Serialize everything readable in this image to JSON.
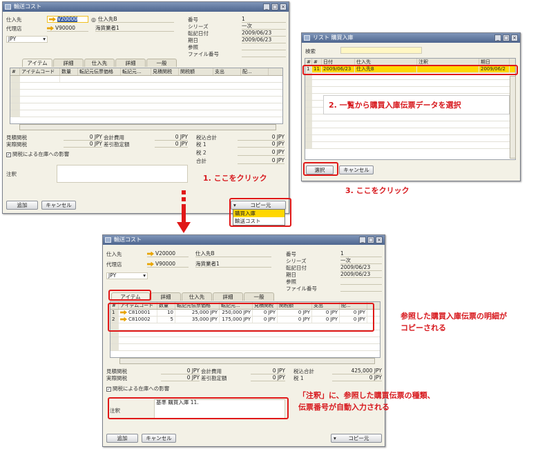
{
  "win1": {
    "title": "輸送コスト",
    "vendor_label": "仕入先",
    "vendor_code": "V20000",
    "vendor_name": "仕入先B",
    "contact_label": "代理店",
    "contact_code": "V90000",
    "contact_name": "海貨業者1",
    "currency": "JPY",
    "right_labels": [
      "番号",
      "シリーズ",
      "転記日付",
      "期日",
      "参照",
      "ファイル番号"
    ],
    "right_values": [
      "1",
      "一次",
      "2009/06/23",
      "2009/06/23",
      "",
      ""
    ],
    "tabs": [
      "アイテム",
      "詳細",
      "仕入先",
      "詳細",
      "一般"
    ],
    "grid_headers": [
      "#",
      "アイテムコード",
      "数量",
      "転記元伝票価格",
      "転記元...",
      "見積関税",
      "関税額",
      "支出",
      "配..."
    ],
    "summary_left_labels": [
      "見積関税",
      "実際関税"
    ],
    "summary_left_values": [
      "0 JPY",
      "0 JPY"
    ],
    "summary_mid_labels": [
      "会計費用",
      "差引勘定額"
    ],
    "summary_mid_values": [
      "0 JPY",
      "0 JPY"
    ],
    "summary_right_labels": [
      "税込合計",
      "税 1",
      "税 2",
      "合計"
    ],
    "summary_right_values": [
      "0 JPY",
      "0 JPY",
      "0 JPY",
      "0 JPY"
    ],
    "checkbox_label": "関税による在庫への影響",
    "remarks_label": "注釈",
    "ok_button": "追加",
    "cancel_button": "キャンセル",
    "copy_from": "コピー元",
    "dropdown_items": [
      "購買入庫",
      "輸送コスト"
    ]
  },
  "win2": {
    "title": "リスト 購買入庫",
    "search_label": "検索",
    "headers": [
      "#",
      "#",
      "日付",
      "仕入先",
      "注釈",
      "期日"
    ],
    "row": [
      "1",
      "11",
      "2009/06/23",
      "仕入先B",
      "",
      "2009/06/2"
    ],
    "select_button": "選択",
    "cancel_button": "キャンセル"
  },
  "win3": {
    "title": "輸送コスト",
    "vendor_label": "仕入先",
    "vendor_code": "V20000",
    "vendor_name": "仕入先B",
    "contact_label": "代理店",
    "contact_code": "V90000",
    "contact_name": "海貨業者1",
    "currency": "JPY",
    "right_labels": [
      "番号",
      "シリーズ",
      "転記日付",
      "期日",
      "参照",
      "ファイル番号"
    ],
    "right_values": [
      "1",
      "一次",
      "2009/06/23",
      "2009/06/23",
      "",
      ""
    ],
    "tabs": [
      "アイテム",
      "詳細",
      "仕入先",
      "詳細",
      "一般"
    ],
    "grid_headers": [
      "#",
      "アイテムコード",
      "数量",
      "転記元伝票価格",
      "転記元...",
      "見積関税",
      "関税額",
      "支出",
      "配..."
    ],
    "rows": [
      [
        "1",
        "C810001",
        "10",
        "25,000 JPY",
        "250,000 JPY",
        "0 JPY",
        "0 JPY",
        "0 JPY",
        "0 JPY"
      ],
      [
        "2",
        "C810002",
        "5",
        "35,000 JPY",
        "175,000 JPY",
        "0 JPY",
        "0 JPY",
        "0 JPY",
        "0 JPY"
      ]
    ],
    "summary_left_labels": [
      "見積関税",
      "実際関税"
    ],
    "summary_left_values": [
      "0 JPY",
      "0 JPY"
    ],
    "summary_mid_labels": [
      "会計費用",
      "差引勘定額"
    ],
    "summary_mid_values": [
      "0 JPY",
      "0 JPY"
    ],
    "summary_right_labels": [
      "税込合計",
      "税 1"
    ],
    "summary_right_values": [
      "425,000 JPY",
      "0 JPY"
    ],
    "checkbox_label": "関税による在庫への影響",
    "remarks_label": "注釈",
    "remarks_value": "基準 購買入庫 11.",
    "ok_button": "追加",
    "cancel_button": "キャンセル",
    "copy_from": "コピー元"
  },
  "annotations": {
    "step1": "1. ここをクリック",
    "step2": "2. 一覧から購買入庫伝票データを選択",
    "step3": "3. ここをクリック",
    "note_rows": "参照した購買入庫伝票の明細が\nコピーされる",
    "note_remarks": "「注釈」に、参照した購買伝票の種類、\n伝票番号が自動入力される"
  },
  "colors": {
    "annotation": "#d7181d",
    "highlight": "#ffd700",
    "arrow": "#e01818"
  }
}
